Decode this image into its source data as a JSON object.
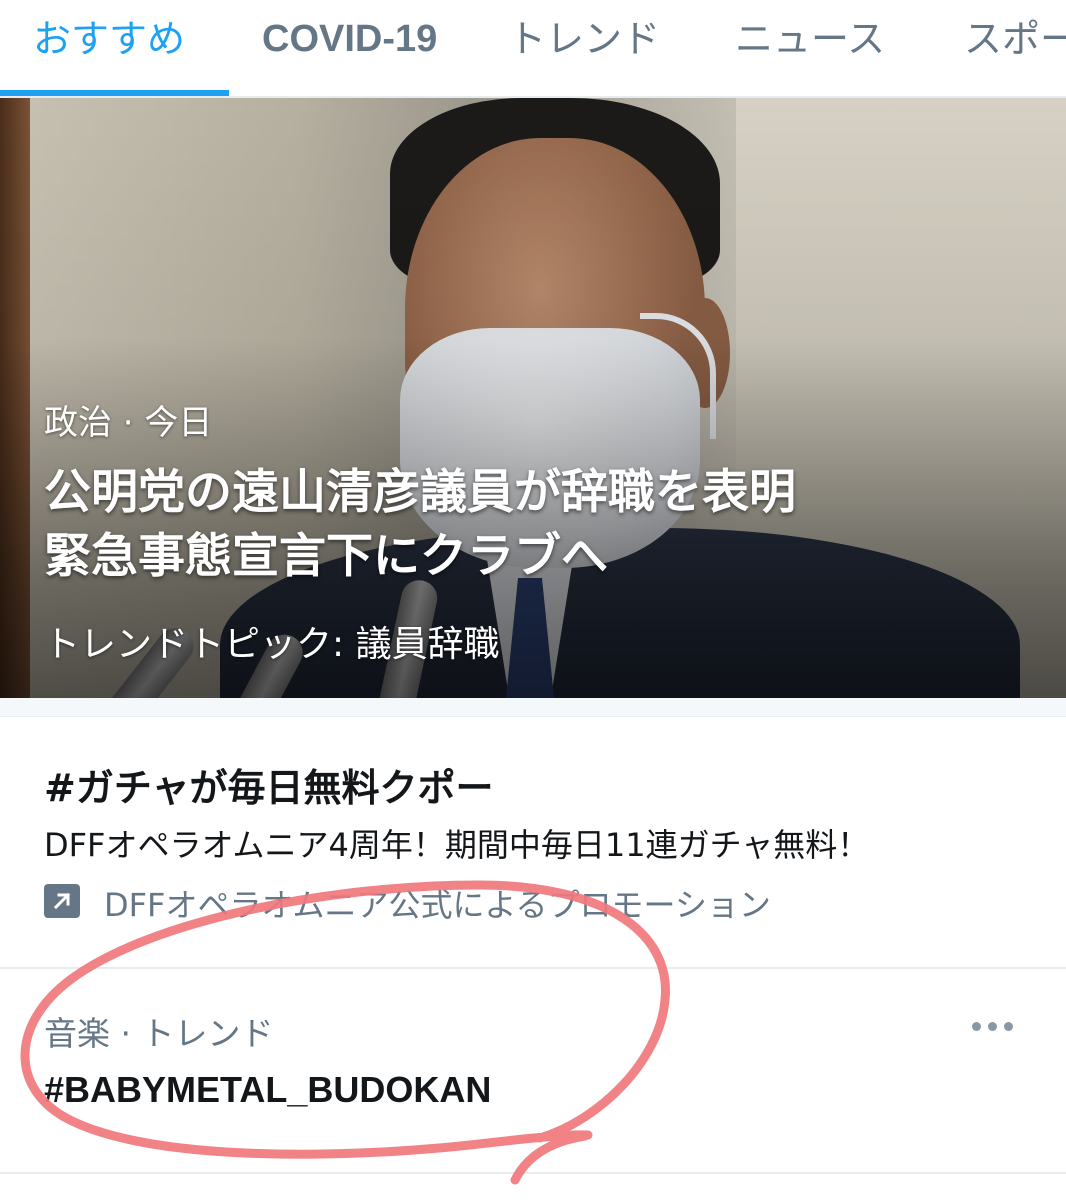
{
  "tabs": [
    {
      "label": "おすすめ",
      "active": true
    },
    {
      "label": "COVID-19",
      "active": false
    },
    {
      "label": "トレンド",
      "active": false
    },
    {
      "label": "ニュース",
      "active": false
    },
    {
      "label": "スポー",
      "active": false
    }
  ],
  "hero": {
    "meta": "政治 · 今日",
    "headline_line1": "公明党の遠山清彦議員が辞職を表明",
    "headline_line2": "緊急事態宣言下にクラブへ",
    "topic": "トレンドトピック: 議員辞職"
  },
  "promo": {
    "title": "#ガチャが毎日無料クポー",
    "description": "DFFオペラオムニア4周年！期間中毎日11連ガチャ無料！",
    "icon": "promoted-arrow-icon",
    "promoted_by": "DFFオペラオムニア公式によるプロモーション"
  },
  "trend": {
    "meta": "音楽 · トレンド",
    "name": "#BABYMETAL_BUDOKAN",
    "more_icon": "more-dots-icon"
  },
  "colors": {
    "accent": "#1da1f2",
    "secondary_text": "#657786",
    "primary_text": "#14171a",
    "divider": "#e6ecf0",
    "annotation": "#f0787c"
  }
}
